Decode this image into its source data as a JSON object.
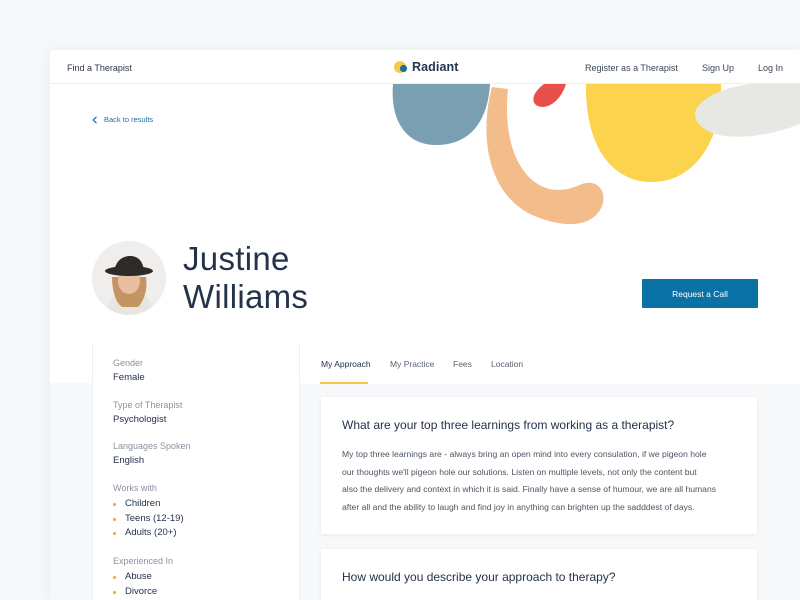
{
  "nav": {
    "find": "Find a Therapist",
    "brand": "Radiant",
    "register": "Register as a Therapist",
    "signup": "Sign Up",
    "login": "Log In"
  },
  "back": {
    "label": "Back to results"
  },
  "profile": {
    "first_name": "Justine",
    "last_name": "Williams",
    "cta": "Request a Call"
  },
  "sidebar": {
    "gender": {
      "label": "Gender",
      "value": "Female"
    },
    "type": {
      "label": "Type of Therapist",
      "value": "Psychologist"
    },
    "languages": {
      "label": "Languages Spoken",
      "value": "English"
    },
    "works_with": {
      "label": "Works with",
      "items": [
        "Children",
        "Teens (12-19)",
        "Adults (20+)"
      ]
    },
    "experienced": {
      "label": "Experienced In",
      "items": [
        "Abuse",
        "Divorce"
      ]
    }
  },
  "tabs": [
    "My Approach",
    "My Practice",
    "Fees",
    "Location"
  ],
  "questions": [
    {
      "title": "What are your top three learnings from working as a therapist?",
      "lines": [
        "My top three learnings are - always bring an open mind into every consulation, if we pigeon hole",
        "our thoughts we'll pigeon hole our solutions. Listen on multiple levels, not only the content but",
        "also the delivery and context in which it is said. Finally have a sense of humour, we are all humans",
        "after all and the ability to laugh and find joy in anything can brighten up the sadddest of days."
      ]
    },
    {
      "title": "How would you describe your approach to therapy?"
    }
  ],
  "colors": {
    "primary": "#0a72a4",
    "accent_yellow": "#fcd34d",
    "blob_blue": "#7a9fb3",
    "blob_peach": "#f2bd8a",
    "blob_red": "#e8504a",
    "blob_gray": "#e7e7e4"
  }
}
